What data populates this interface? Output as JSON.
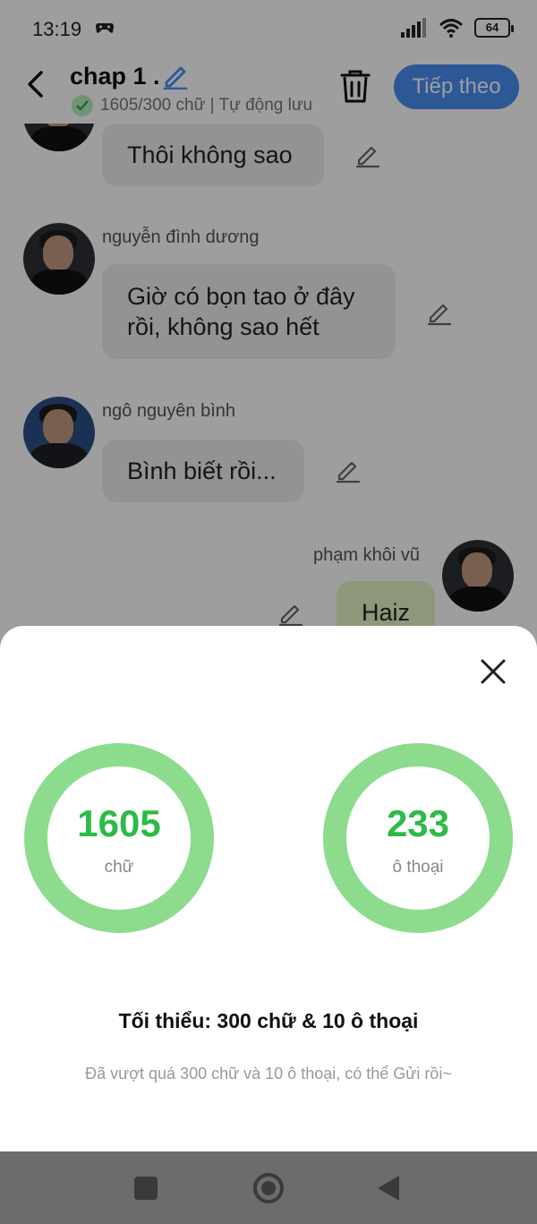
{
  "status_bar": {
    "time": "13:19",
    "battery": "64",
    "icons": [
      "game-controller-icon",
      "signal-icon",
      "wifi-icon",
      "battery-icon"
    ]
  },
  "header": {
    "title": "chap 1 .",
    "meta": "1605/300 chữ | Tự động lưu",
    "next_label": "Tiếp theo",
    "accent_color": "#4a8ff2"
  },
  "chat": {
    "messages": [
      {
        "sender": "",
        "text": "Thôi không sao",
        "side": "left"
      },
      {
        "sender": "nguyễn đình dương",
        "text": "Giờ có bọn tao ở đây rồi, không sao hết",
        "line1": "Giờ có bọn tao ở đây",
        "line2": "rồi, không sao hết",
        "side": "left"
      },
      {
        "sender": "ngô nguyên bình",
        "text": "Bình biết rồi...",
        "side": "left"
      },
      {
        "sender": "phạm khôi vũ",
        "text": "Haiz",
        "side": "right"
      }
    ]
  },
  "sheet": {
    "words": {
      "value": "1605",
      "label": "chữ"
    },
    "dialogues": {
      "value": "233",
      "label": "ô thoại"
    },
    "minimum": "Tối thiểu: 300 chữ & 10 ô thoại",
    "hint": "Đã vượt quá 300 chữ và 10 ô thoại, có thể Gửi rồi~",
    "ring_color": "#8ddc8e",
    "number_color": "#2cbb46"
  }
}
